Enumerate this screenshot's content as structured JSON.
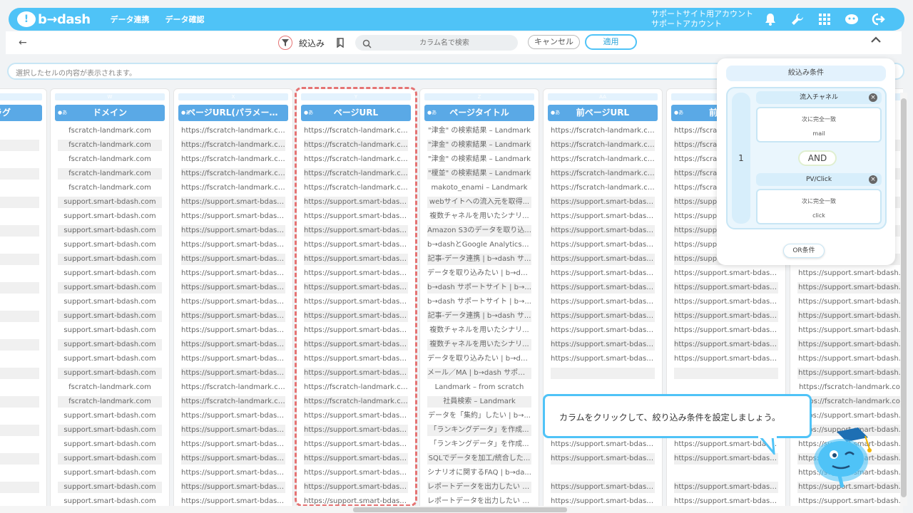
{
  "header": {
    "logo_mark": "!",
    "logo_text": "b→dash",
    "nav": [
      "データ連携",
      "データ確認"
    ],
    "account_line1": "サポートサイト用アカウント",
    "account_line2": "サポートアカウント"
  },
  "filterbar": {
    "back": "←",
    "label": "絞込み",
    "search_placeholder": "カラム名で検索",
    "cancel": "キャンセル",
    "apply": "適用",
    "collapse": "^"
  },
  "cellbar": {
    "placeholder": "選択したセルの内容が表示されます。"
  },
  "columns": [
    {
      "letter": "",
      "type": "",
      "header": "ラグ",
      "cells": []
    },
    {
      "letter": "W",
      "type": "●あ",
      "header": "ドメイン",
      "cells": [
        "fscratch-landmark.com",
        "fscratch-landmark.com",
        "fscratch-landmark.com",
        "fscratch-landmark.com",
        "fscratch-landmark.com",
        "support.smart-bdash.com",
        "support.smart-bdash.com",
        "support.smart-bdash.com",
        "support.smart-bdash.com",
        "support.smart-bdash.com",
        "support.smart-bdash.com",
        "support.smart-bdash.com",
        "support.smart-bdash.com",
        "support.smart-bdash.com",
        "support.smart-bdash.com",
        "support.smart-bdash.com",
        "support.smart-bdash.com",
        "support.smart-bdash.com",
        "fscratch-landmark.com",
        "fscratch-landmark.com",
        "support.smart-bdash.com",
        "support.smart-bdash.com",
        "support.smart-bdash.com",
        "support.smart-bdash.com",
        "support.smart-bdash.com",
        "support.smart-bdash.com",
        "support.smart-bdash.com"
      ]
    },
    {
      "letter": "X",
      "type": "●あ",
      "header": "ページURL(パラメータ...",
      "cells": [
        "https://fscratch-landmark.com",
        "https://fscratch-landmark.com",
        "https://fscratch-landmark.com",
        "https://fscratch-landmark.com",
        "https://fscratch-landmark.com",
        "https://support.smart-bdash.com",
        "https://support.smart-bdash.com",
        "https://support.smart-bdash.com",
        "https://support.smart-bdash.com",
        "https://support.smart-bdash.com",
        "https://support.smart-bdash.com",
        "https://support.smart-bdash.com",
        "https://support.smart-bdash.com",
        "https://support.smart-bdash.com",
        "https://support.smart-bdash.com",
        "https://support.smart-bdash.com",
        "https://support.smart-bdash.com",
        "https://support.smart-bdash.com",
        "https://fscratch-landmark.com",
        "https://fscratch-landmark.com",
        "https://support.smart-bdash.com",
        "https://support.smart-bdash.com",
        "https://support.smart-bdash.com",
        "https://support.smart-bdash.com",
        "https://support.smart-bdash.com",
        "https://support.smart-bdash.com",
        "https://support.smart-bdash.com"
      ]
    },
    {
      "letter": "Y",
      "type": "●あ",
      "header": "ページURL",
      "cells": [
        "https://fscratch-landmark.com",
        "https://fscratch-landmark.com",
        "https://fscratch-landmark.com",
        "https://fscratch-landmark.com",
        "https://fscratch-landmark.com",
        "https://support.smart-bdash.com",
        "https://support.smart-bdash.com",
        "https://support.smart-bdash.com",
        "https://support.smart-bdash.com",
        "https://support.smart-bdash.com",
        "https://support.smart-bdash.com",
        "https://support.smart-bdash.com",
        "https://support.smart-bdash.com",
        "https://support.smart-bdash.com",
        "https://support.smart-bdash.com",
        "https://support.smart-bdash.com",
        "https://support.smart-bdash.com",
        "https://support.smart-bdash.com",
        "https://fscratch-landmark.com",
        "https://fscratch-landmark.com",
        "https://support.smart-bdash.com",
        "https://support.smart-bdash.com",
        "https://support.smart-bdash.com",
        "https://support.smart-bdash.com",
        "https://support.smart-bdash.com",
        "https://support.smart-bdash.com",
        "https://support.smart-bdash.com"
      ]
    },
    {
      "letter": "Z",
      "type": "●あ",
      "header": "ページタイトル",
      "cells": [
        "\"津金\" の検索結果 – Landmark",
        "\"津金\" の検索結果 – Landmark",
        "\"津金\" の検索結果 – Landmark",
        "\"榎並\" の検索結果 – Landmark",
        "makoto_enami – Landmark",
        "webサイトへの流入元を取得...",
        "複数チャネルを用いたシナリ...",
        "Amazon S3のデータを取り込...",
        "b→dashとGoogle Analyticsの...",
        "記事-データ連携 | b→dash サ...",
        "データを取り込みたい | b→da...",
        "b→dash サポートサイト | b→...",
        "b→dash サポートサイト | b→...",
        "記事-データ連携 | b→dash サ...",
        "複数チャネルを用いたシナリ...",
        "複数チャネルを用いたシナリ...",
        "データを取り込みたい | b→da...",
        "メール／MA | b→dash サポー...",
        "Landmark – from scratch",
        "社員検索 – Landmark",
        "データを「集約」したい | b→...",
        "「ランキングデータ」を作成...",
        "「ランキングデータ」を作成...",
        "SQLでデータを加工/統合した...",
        "シナリオに関するFAQ | b→da...",
        "レポートデータを出力したい |...",
        "レポートデータを出力したい |..."
      ]
    },
    {
      "letter": "AA",
      "type": "●あ",
      "header": "前ページURL",
      "cells": [
        "https://fscratch-landmark.com",
        "https://fscratch-landmark.com",
        "https://fscratch-landmark.com",
        "https://fscratch-landmark.com",
        "https://fscratch-landmark.com",
        "https://support.smart-bdash.com",
        "https://support.smart-bdash.com",
        "https://support.smart-bdash.com",
        "https://support.smart-bdash.com",
        "https://support.smart-bdash.com",
        "https://support.smart-bdash.com",
        "https://support.smart-bdash.com",
        "https://support.smart-bdash.com",
        "https://support.smart-bdash.com",
        "https://support.smart-bdash.com",
        "https://support.smart-bdash.com",
        "https://support.smart-bdash.com",
        "",
        "",
        "",
        "",
        "https://support.smart-bdash.com",
        "https://support.smart-bdash.com",
        "https://support.smart-bdash.com",
        "",
        "https://support.smart-bdash.com",
        "https://support.smart-bdash.com"
      ]
    },
    {
      "letter": "",
      "type": "●あ",
      "header": "前ページ",
      "cells": [
        "https://fscratch-landmark.com",
        "https://fscratch-landmark.com",
        "https://fscratch-landmark.com",
        "https://fscratch-landmark.com",
        "https://fscratch-landmark.com",
        "https://support.smart-bdash.com",
        "https://support.smart-bdash.com",
        "https://support.smart-bdash.com",
        "https://support.smart-bdash.com",
        "https://support.smart-bdash.com",
        "https://support.smart-bdash.com",
        "https://support.smart-bdash.com",
        "https://support.smart-bdash.com",
        "https://support.smart-bdash.com",
        "https://support.smart-bdash.com",
        "https://support.smart-bdash.com",
        "https://support.smart-bdash.com",
        "",
        "",
        "",
        "",
        "https://support.smart-bdash.com",
        "https://support.smart-bdash.com",
        "https://support.smart-bdash.com",
        "",
        "https://support.smart-bdash.com",
        "https://support.smart-bdash.com"
      ]
    },
    {
      "letter": "",
      "type": "",
      "header": "",
      "cells": [
        "",
        "",
        "",
        "",
        "",
        "",
        "",
        "",
        "",
        "",
        "https://support.smart-bdash.",
        "https://support.smart-bdash.",
        "https://support.smart-bdash.",
        "https://support.smart-bdash.",
        "https://support.smart-bdash.",
        "https://support.smart-bdash.",
        "https://support.smart-bdash.",
        "https://support.smart-bdash.",
        "https://fscratch-landmark.co",
        "https://fscratch-landmark.co",
        "https://support.smart-bdash.",
        "https://support.smart-bdash.",
        "https://support.smart-bdash.",
        "https://support.smart-bdash.",
        "https://support.smart-bdash.",
        "https://support.smart-bdash.",
        "https://support.smart-bdash."
      ]
    }
  ],
  "panel": {
    "title": "絞込み条件",
    "group_number": "1",
    "conditions": [
      {
        "field": "流入チャネル",
        "operator": "次に完全一致",
        "value": "mail"
      },
      {
        "field": "PV/Click",
        "operator": "次に完全一致",
        "value": "click"
      }
    ],
    "and_label": "AND",
    "or_label": "OR条件",
    "remove": "×"
  },
  "tooltip": {
    "text": "カラムをクリックして、絞り込み条件を設定しましょう。"
  },
  "colors": {
    "accent": "#4fc3f7",
    "header_cell": "#5aa9e6",
    "selection": "#e57373"
  }
}
